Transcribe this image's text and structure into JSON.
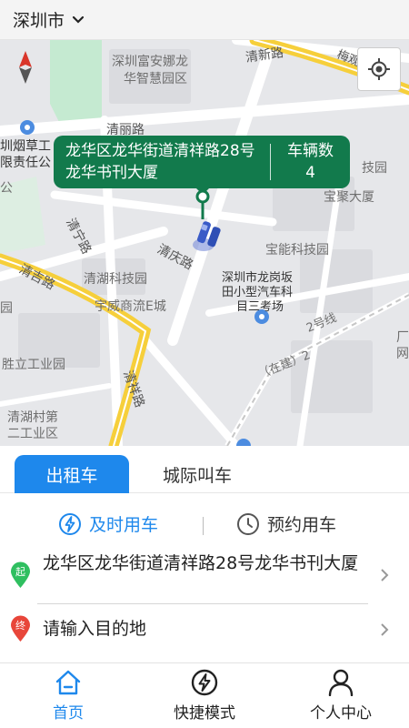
{
  "header": {
    "city": "深圳市"
  },
  "map": {
    "bubble": {
      "address": "龙华区龙华街道清祥路28号龙华书刊大厦",
      "count_label": "车辆数",
      "count_value": "4"
    },
    "labels": {
      "poi_1": "深圳富安娜龙",
      "poi_1b": "华智慧园区",
      "road_qingxin": "清新路",
      "road_qingli": "清丽路",
      "tobacco_1": "圳烟草工",
      "tobacco_2": "限责任公",
      "jiyuan": "技园",
      "baoju": "宝聚大厦",
      "road_qingning": "清宁路",
      "baoneng": "宝能科技园",
      "road_qingqing": "清庆路",
      "road_qingji": "清吉路",
      "qinghu_park": "清湖科技园",
      "longgang_1": "深圳市龙岗坂",
      "longgang_2": "田小型汽车科",
      "longgang_3": "目三考场",
      "yuwei": "宇威商流E城",
      "line_2": "2号线",
      "line_zaijian": "（在建）2",
      "shengli": "胜立工业园",
      "road_qingxiang": "清祥路",
      "qinghu_village_1": "清湖村第",
      "qinghu_village_2": "二工业区",
      "expressway": "梅观高速",
      "edge_s": "公",
      "edge_v": "园",
      "edge_r1": "厂",
      "edge_r2": "网"
    }
  },
  "tabs": {
    "taxi": "出租车",
    "intercity": "城际叫车"
  },
  "modes": {
    "now": "及时用车",
    "book": "预约用车"
  },
  "start": {
    "marker": "起",
    "address": "龙华区龙华街道清祥路28号龙华书刊大厦"
  },
  "destination": {
    "marker": "终",
    "placeholder": "请输入目的地"
  },
  "nav": {
    "home": "首页",
    "quick": "快捷模式",
    "profile": "个人中心"
  },
  "colors": {
    "accent": "#1e88ec",
    "bubble": "#127a4c",
    "start_marker": "#2fbf60",
    "dest_marker": "#e8463a"
  }
}
